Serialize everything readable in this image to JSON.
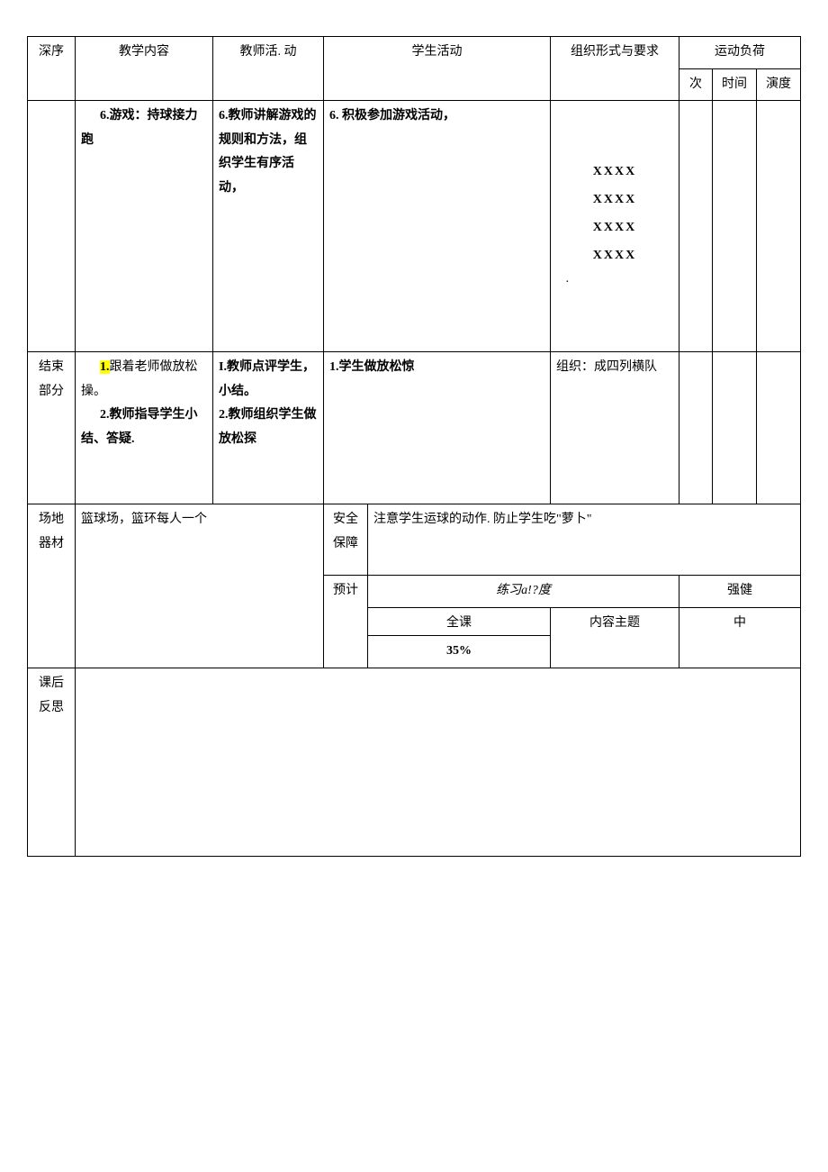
{
  "header": {
    "col_sequence": "深序",
    "col_content": "教学内容",
    "col_teacher": "教师活. 动",
    "col_student": "学生活动",
    "col_org": "组织形式与要求",
    "col_load_group": "运动负荷",
    "col_times": "次",
    "col_duration": "时间",
    "col_intensity": "演度"
  },
  "row_game": {
    "content": "6.游戏：持球接力跑",
    "teacher": "6.教师讲解游戏的规则和方法，组织学生有序活动，",
    "student": "6. 积极参加游戏活动，",
    "formation_line1": "XXXX",
    "formation_line2": "XXXX",
    "formation_line3": "XXXX",
    "formation_line4": "XXXX",
    "formation_dot": "·"
  },
  "row_end": {
    "label": "结束部分",
    "content_part_a_prefix": "1.",
    "content_part_a": "跟着老师做放松操。",
    "content_part_b": "2.教师指导学生小结、答疑.",
    "teacher_a": "I.教师点评学生，小结。",
    "teacher_b": "2.教师组织学生做放松探",
    "student_a": "1.学生做放松惊",
    "org": "组织：成四列横队"
  },
  "row_equipment": {
    "label": "场地器材",
    "content": "篮球场，篮环每人一个",
    "safety_label": "安全保障",
    "safety_text": "注意学生运球的动作. 防止学生吃\"萝卜\"",
    "forecast_label": "预计",
    "practice_density_label": "练习a!?度",
    "strength_label": "强健",
    "whole_class": "全课",
    "content_theme": "内容主题",
    "percent": "35%",
    "strength_value": "中"
  },
  "row_reflection": {
    "label": "课后反思"
  }
}
